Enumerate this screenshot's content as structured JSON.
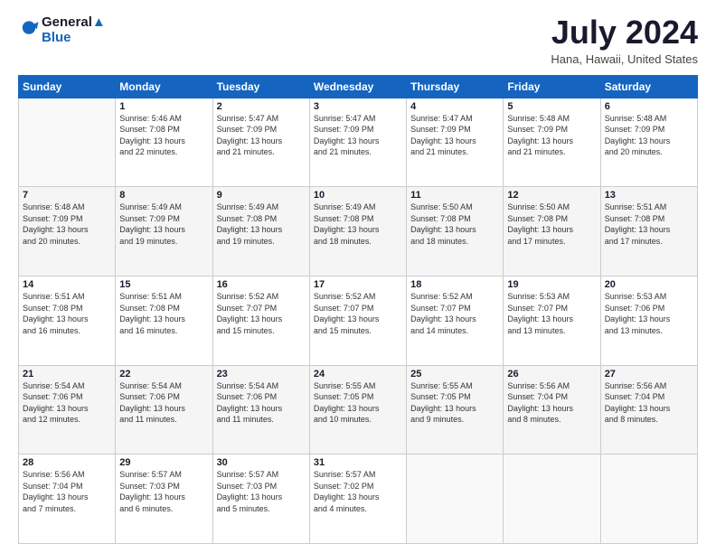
{
  "header": {
    "logo_line1": "General",
    "logo_line2": "Blue",
    "month": "July 2024",
    "location": "Hana, Hawaii, United States"
  },
  "weekdays": [
    "Sunday",
    "Monday",
    "Tuesday",
    "Wednesday",
    "Thursday",
    "Friday",
    "Saturday"
  ],
  "weeks": [
    [
      {
        "day": "",
        "info": ""
      },
      {
        "day": "1",
        "info": "Sunrise: 5:46 AM\nSunset: 7:08 PM\nDaylight: 13 hours\nand 22 minutes."
      },
      {
        "day": "2",
        "info": "Sunrise: 5:47 AM\nSunset: 7:09 PM\nDaylight: 13 hours\nand 21 minutes."
      },
      {
        "day": "3",
        "info": "Sunrise: 5:47 AM\nSunset: 7:09 PM\nDaylight: 13 hours\nand 21 minutes."
      },
      {
        "day": "4",
        "info": "Sunrise: 5:47 AM\nSunset: 7:09 PM\nDaylight: 13 hours\nand 21 minutes."
      },
      {
        "day": "5",
        "info": "Sunrise: 5:48 AM\nSunset: 7:09 PM\nDaylight: 13 hours\nand 21 minutes."
      },
      {
        "day": "6",
        "info": "Sunrise: 5:48 AM\nSunset: 7:09 PM\nDaylight: 13 hours\nand 20 minutes."
      }
    ],
    [
      {
        "day": "7",
        "info": "Sunrise: 5:48 AM\nSunset: 7:09 PM\nDaylight: 13 hours\nand 20 minutes."
      },
      {
        "day": "8",
        "info": "Sunrise: 5:49 AM\nSunset: 7:09 PM\nDaylight: 13 hours\nand 19 minutes."
      },
      {
        "day": "9",
        "info": "Sunrise: 5:49 AM\nSunset: 7:08 PM\nDaylight: 13 hours\nand 19 minutes."
      },
      {
        "day": "10",
        "info": "Sunrise: 5:49 AM\nSunset: 7:08 PM\nDaylight: 13 hours\nand 18 minutes."
      },
      {
        "day": "11",
        "info": "Sunrise: 5:50 AM\nSunset: 7:08 PM\nDaylight: 13 hours\nand 18 minutes."
      },
      {
        "day": "12",
        "info": "Sunrise: 5:50 AM\nSunset: 7:08 PM\nDaylight: 13 hours\nand 17 minutes."
      },
      {
        "day": "13",
        "info": "Sunrise: 5:51 AM\nSunset: 7:08 PM\nDaylight: 13 hours\nand 17 minutes."
      }
    ],
    [
      {
        "day": "14",
        "info": "Sunrise: 5:51 AM\nSunset: 7:08 PM\nDaylight: 13 hours\nand 16 minutes."
      },
      {
        "day": "15",
        "info": "Sunrise: 5:51 AM\nSunset: 7:08 PM\nDaylight: 13 hours\nand 16 minutes."
      },
      {
        "day": "16",
        "info": "Sunrise: 5:52 AM\nSunset: 7:07 PM\nDaylight: 13 hours\nand 15 minutes."
      },
      {
        "day": "17",
        "info": "Sunrise: 5:52 AM\nSunset: 7:07 PM\nDaylight: 13 hours\nand 15 minutes."
      },
      {
        "day": "18",
        "info": "Sunrise: 5:52 AM\nSunset: 7:07 PM\nDaylight: 13 hours\nand 14 minutes."
      },
      {
        "day": "19",
        "info": "Sunrise: 5:53 AM\nSunset: 7:07 PM\nDaylight: 13 hours\nand 13 minutes."
      },
      {
        "day": "20",
        "info": "Sunrise: 5:53 AM\nSunset: 7:06 PM\nDaylight: 13 hours\nand 13 minutes."
      }
    ],
    [
      {
        "day": "21",
        "info": "Sunrise: 5:54 AM\nSunset: 7:06 PM\nDaylight: 13 hours\nand 12 minutes."
      },
      {
        "day": "22",
        "info": "Sunrise: 5:54 AM\nSunset: 7:06 PM\nDaylight: 13 hours\nand 11 minutes."
      },
      {
        "day": "23",
        "info": "Sunrise: 5:54 AM\nSunset: 7:06 PM\nDaylight: 13 hours\nand 11 minutes."
      },
      {
        "day": "24",
        "info": "Sunrise: 5:55 AM\nSunset: 7:05 PM\nDaylight: 13 hours\nand 10 minutes."
      },
      {
        "day": "25",
        "info": "Sunrise: 5:55 AM\nSunset: 7:05 PM\nDaylight: 13 hours\nand 9 minutes."
      },
      {
        "day": "26",
        "info": "Sunrise: 5:56 AM\nSunset: 7:04 PM\nDaylight: 13 hours\nand 8 minutes."
      },
      {
        "day": "27",
        "info": "Sunrise: 5:56 AM\nSunset: 7:04 PM\nDaylight: 13 hours\nand 8 minutes."
      }
    ],
    [
      {
        "day": "28",
        "info": "Sunrise: 5:56 AM\nSunset: 7:04 PM\nDaylight: 13 hours\nand 7 minutes."
      },
      {
        "day": "29",
        "info": "Sunrise: 5:57 AM\nSunset: 7:03 PM\nDaylight: 13 hours\nand 6 minutes."
      },
      {
        "day": "30",
        "info": "Sunrise: 5:57 AM\nSunset: 7:03 PM\nDaylight: 13 hours\nand 5 minutes."
      },
      {
        "day": "31",
        "info": "Sunrise: 5:57 AM\nSunset: 7:02 PM\nDaylight: 13 hours\nand 4 minutes."
      },
      {
        "day": "",
        "info": ""
      },
      {
        "day": "",
        "info": ""
      },
      {
        "day": "",
        "info": ""
      }
    ]
  ]
}
